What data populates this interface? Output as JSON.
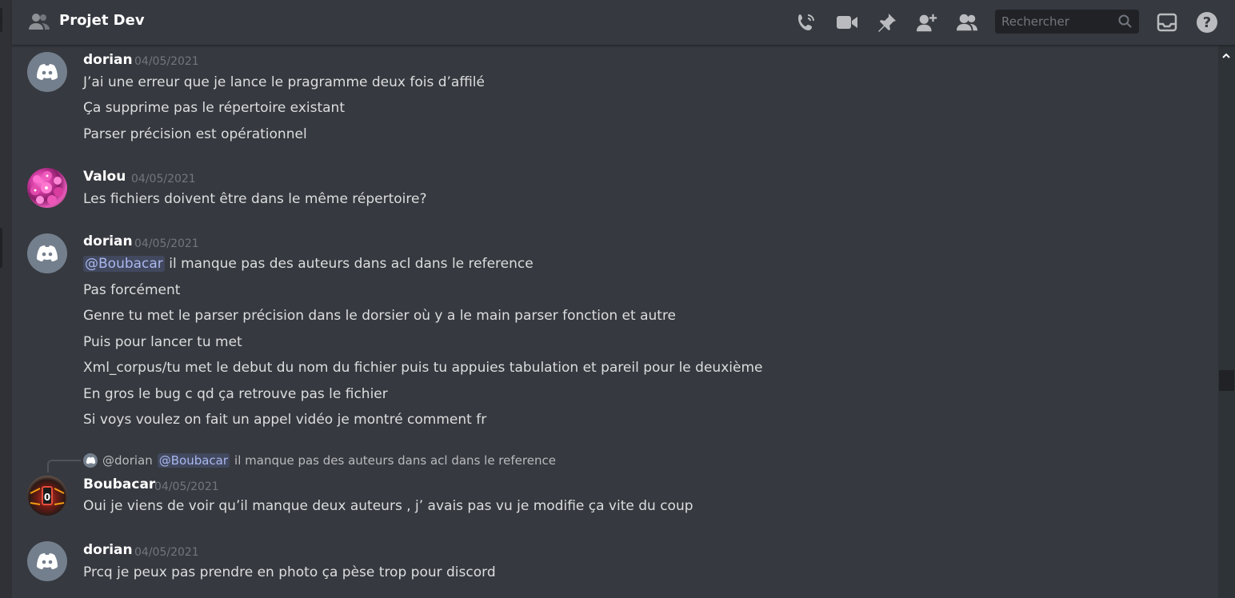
{
  "header": {
    "title": "Projet Dev",
    "search_placeholder": "Rechercher",
    "icons": [
      "people-icon",
      "call-icon",
      "video-icon",
      "pin-icon",
      "add-member-icon",
      "members-icon",
      "search-icon",
      "inbox-icon",
      "help-icon"
    ]
  },
  "colors": {
    "background": "#36393f",
    "header_bg": "#36393f",
    "mention_text": "#a9b8ef",
    "timestamp": "#72767d",
    "discord_avatar": "#747f8d"
  },
  "messages": [
    {
      "author": "dorian",
      "timestamp": "04/05/2021",
      "avatar": "discord-default",
      "lines": [
        "J’ai une erreur que je lance le pragramme deux fois d’affilé",
        "Ça supprime pas le répertoire existant",
        "Parser précision est opérationnel"
      ]
    },
    {
      "author": "Valou",
      "timestamp": "04/05/2021",
      "avatar": "pink-flowers",
      "lines": [
        "Les fichiers doivent être dans le même répertoire?"
      ]
    },
    {
      "author": "dorian",
      "timestamp": "04/05/2021",
      "avatar": "discord-default",
      "mention": "@Boubacar",
      "lines": [
        " il manque pas des auteurs dans acl dans le reference",
        "Pas forcément",
        "Genre tu met le parser précision dans le dorsier où y a le main parser fonction et autre",
        "Puis pour lancer tu met",
        "Xml_corpus/tu met le debut du nom du fichier puis tu appuies tabulation et pareil pour le deuxième",
        "En gros le bug c qd ça retrouve pas le fichier",
        "Si voys voulez on fait un appel vidéo je montré comment fr"
      ]
    },
    {
      "reply": {
        "author": "@dorian",
        "mention": "@Boubacar",
        "text": "il manque pas des auteurs dans acl dans le reference"
      },
      "author": "Boubacar",
      "timestamp": "04/05/2021",
      "avatar": "game-art",
      "lines": [
        "Oui je viens de voir qu’il manque deux auteurs , j’ avais pas vu je modifie ça vite du coup"
      ]
    },
    {
      "author": "dorian",
      "timestamp": "04/05/2021",
      "avatar": "discord-default",
      "lines": [
        "Prcq je peux pas prendre en photo ça pèse trop pour discord"
      ]
    }
  ]
}
